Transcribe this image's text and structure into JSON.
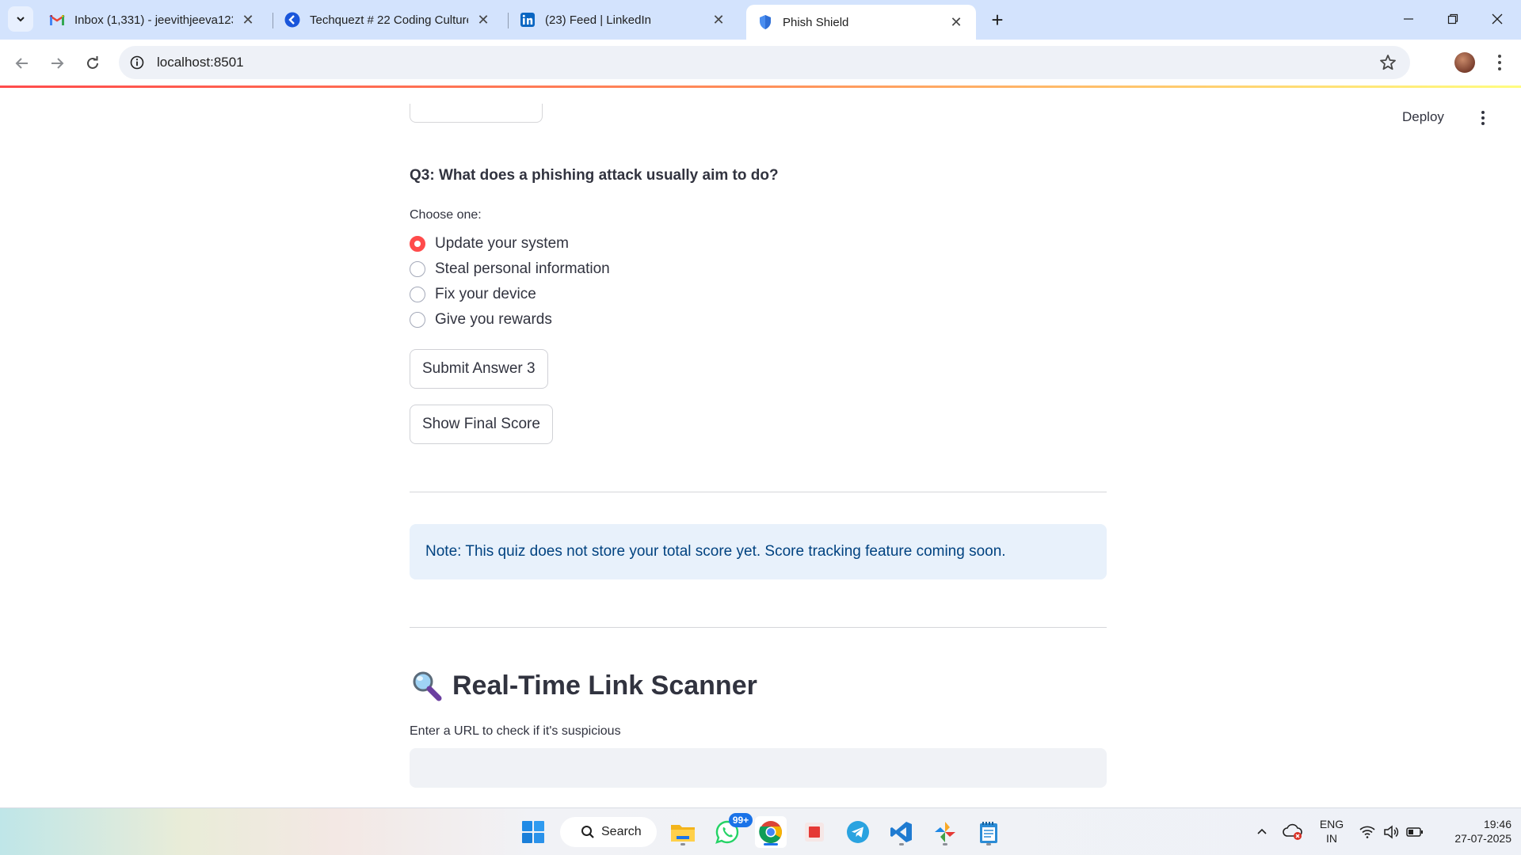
{
  "browser": {
    "tabs": [
      {
        "title": "Inbox (1,331) - jeevithjeeva1234",
        "favicon": "gmail-icon"
      },
      {
        "title": "Techquezt # 22 Coding Culture",
        "favicon": "techquezt-icon"
      },
      {
        "title": "(23) Feed | LinkedIn",
        "favicon": "linkedin-icon"
      },
      {
        "title": "Phish Shield",
        "favicon": "shield-icon",
        "active": true
      }
    ],
    "url": "localhost:8501"
  },
  "app": {
    "deploy_label": "Deploy",
    "question": "Q3: What does a phishing attack usually aim to do?",
    "choose_label": "Choose one:",
    "options": [
      {
        "label": "Update your system",
        "selected": true
      },
      {
        "label": "Steal personal information",
        "selected": false
      },
      {
        "label": "Fix your device",
        "selected": false
      },
      {
        "label": "Give you rewards",
        "selected": false
      }
    ],
    "submit_label": "Submit Answer 3",
    "final_score_label": "Show Final Score",
    "note": "Note: This quiz does not store your total score yet. Score tracking feature coming soon.",
    "scanner_title": "Real-Time Link Scanner",
    "scanner_icon": "magnifying-glass-icon",
    "url_input_label": "Enter a URL to check if it's suspicious",
    "url_input_value": ""
  },
  "taskbar": {
    "search_label": "Search",
    "whatsapp_badge": "99+",
    "language": "ENG",
    "region": "IN",
    "time": "19:46",
    "date": "27-07-2025"
  },
  "colors": {
    "accent": "#ff4b4b",
    "note_bg": "#e8f1fb",
    "note_text": "#004280",
    "tabbar_bg": "#d3e3fd"
  }
}
